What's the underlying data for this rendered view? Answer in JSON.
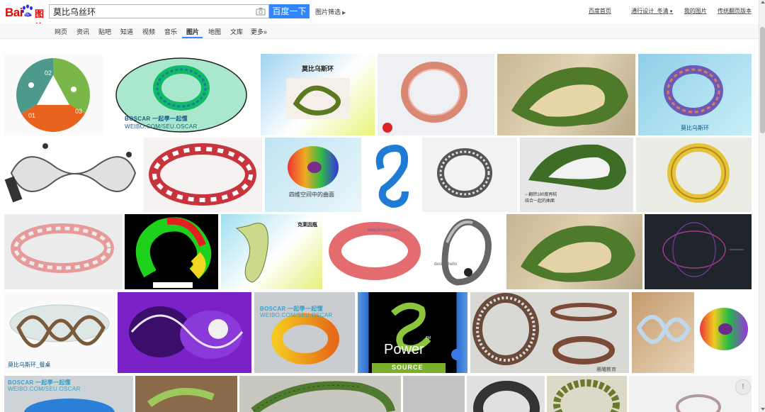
{
  "logo": {
    "text": "Bai",
    "sub": "图片"
  },
  "search": {
    "value": "莫比乌丝环",
    "button_label": "百度一下",
    "filter_label": "图片筛选"
  },
  "top_links": [
    "百度首页",
    "通行设计_冬清",
    "我的图片",
    "传统翻页版本"
  ],
  "tabs": [
    "网页",
    "资讯",
    "贴吧",
    "知道",
    "视频",
    "音乐",
    "图片",
    "地图",
    "文库",
    "更多»"
  ],
  "active_tab": "图片",
  "tiles": {
    "t01": {
      "n1": "02",
      "n2": "01",
      "n3": "03"
    },
    "t02": {
      "wm1": "BOSCAR 一起學一起懂",
      "wm2": "WEIBO.COM/SEU.OSCAR"
    },
    "t03": {
      "title": "莫比乌斯环"
    },
    "t06": {
      "caption": "莫比乌斯环"
    },
    "t09": {
      "caption": "四维空间中的曲面"
    },
    "t12": {
      "caption1": "○ 翻转180度再粘",
      "caption2": "结合一起的曲面"
    },
    "t16": {
      "title": "克莱因瓶"
    },
    "t17": {
      "url": "www.foocas.com"
    },
    "t18": {
      "url": "design.hello"
    },
    "t21": {
      "caption": "莫比乌斯环_餐桌"
    },
    "t23": {
      "wm1": "BOSCAR 一起學一起懂",
      "wm2": "WEIBO.COM/SEU.OSCAR"
    },
    "t24": {
      "power": "Power",
      "source": "SOURCE",
      "tm": "TM"
    },
    "t25": {
      "watermark": "晨曦教育"
    },
    "t28": {
      "wm1": "BOSCAR 一起學一起懂",
      "wm2": "WEIBO.COM/SEU.OSCAR"
    }
  },
  "float_button": "!",
  "colors": {
    "brand_red": "#e10601",
    "button_blue": "#3385ff",
    "tab_underline": "#38f"
  },
  "icons": {
    "camera": "camera-icon",
    "paw": "baidu-paw-icon",
    "caret": "caret-down-icon"
  }
}
